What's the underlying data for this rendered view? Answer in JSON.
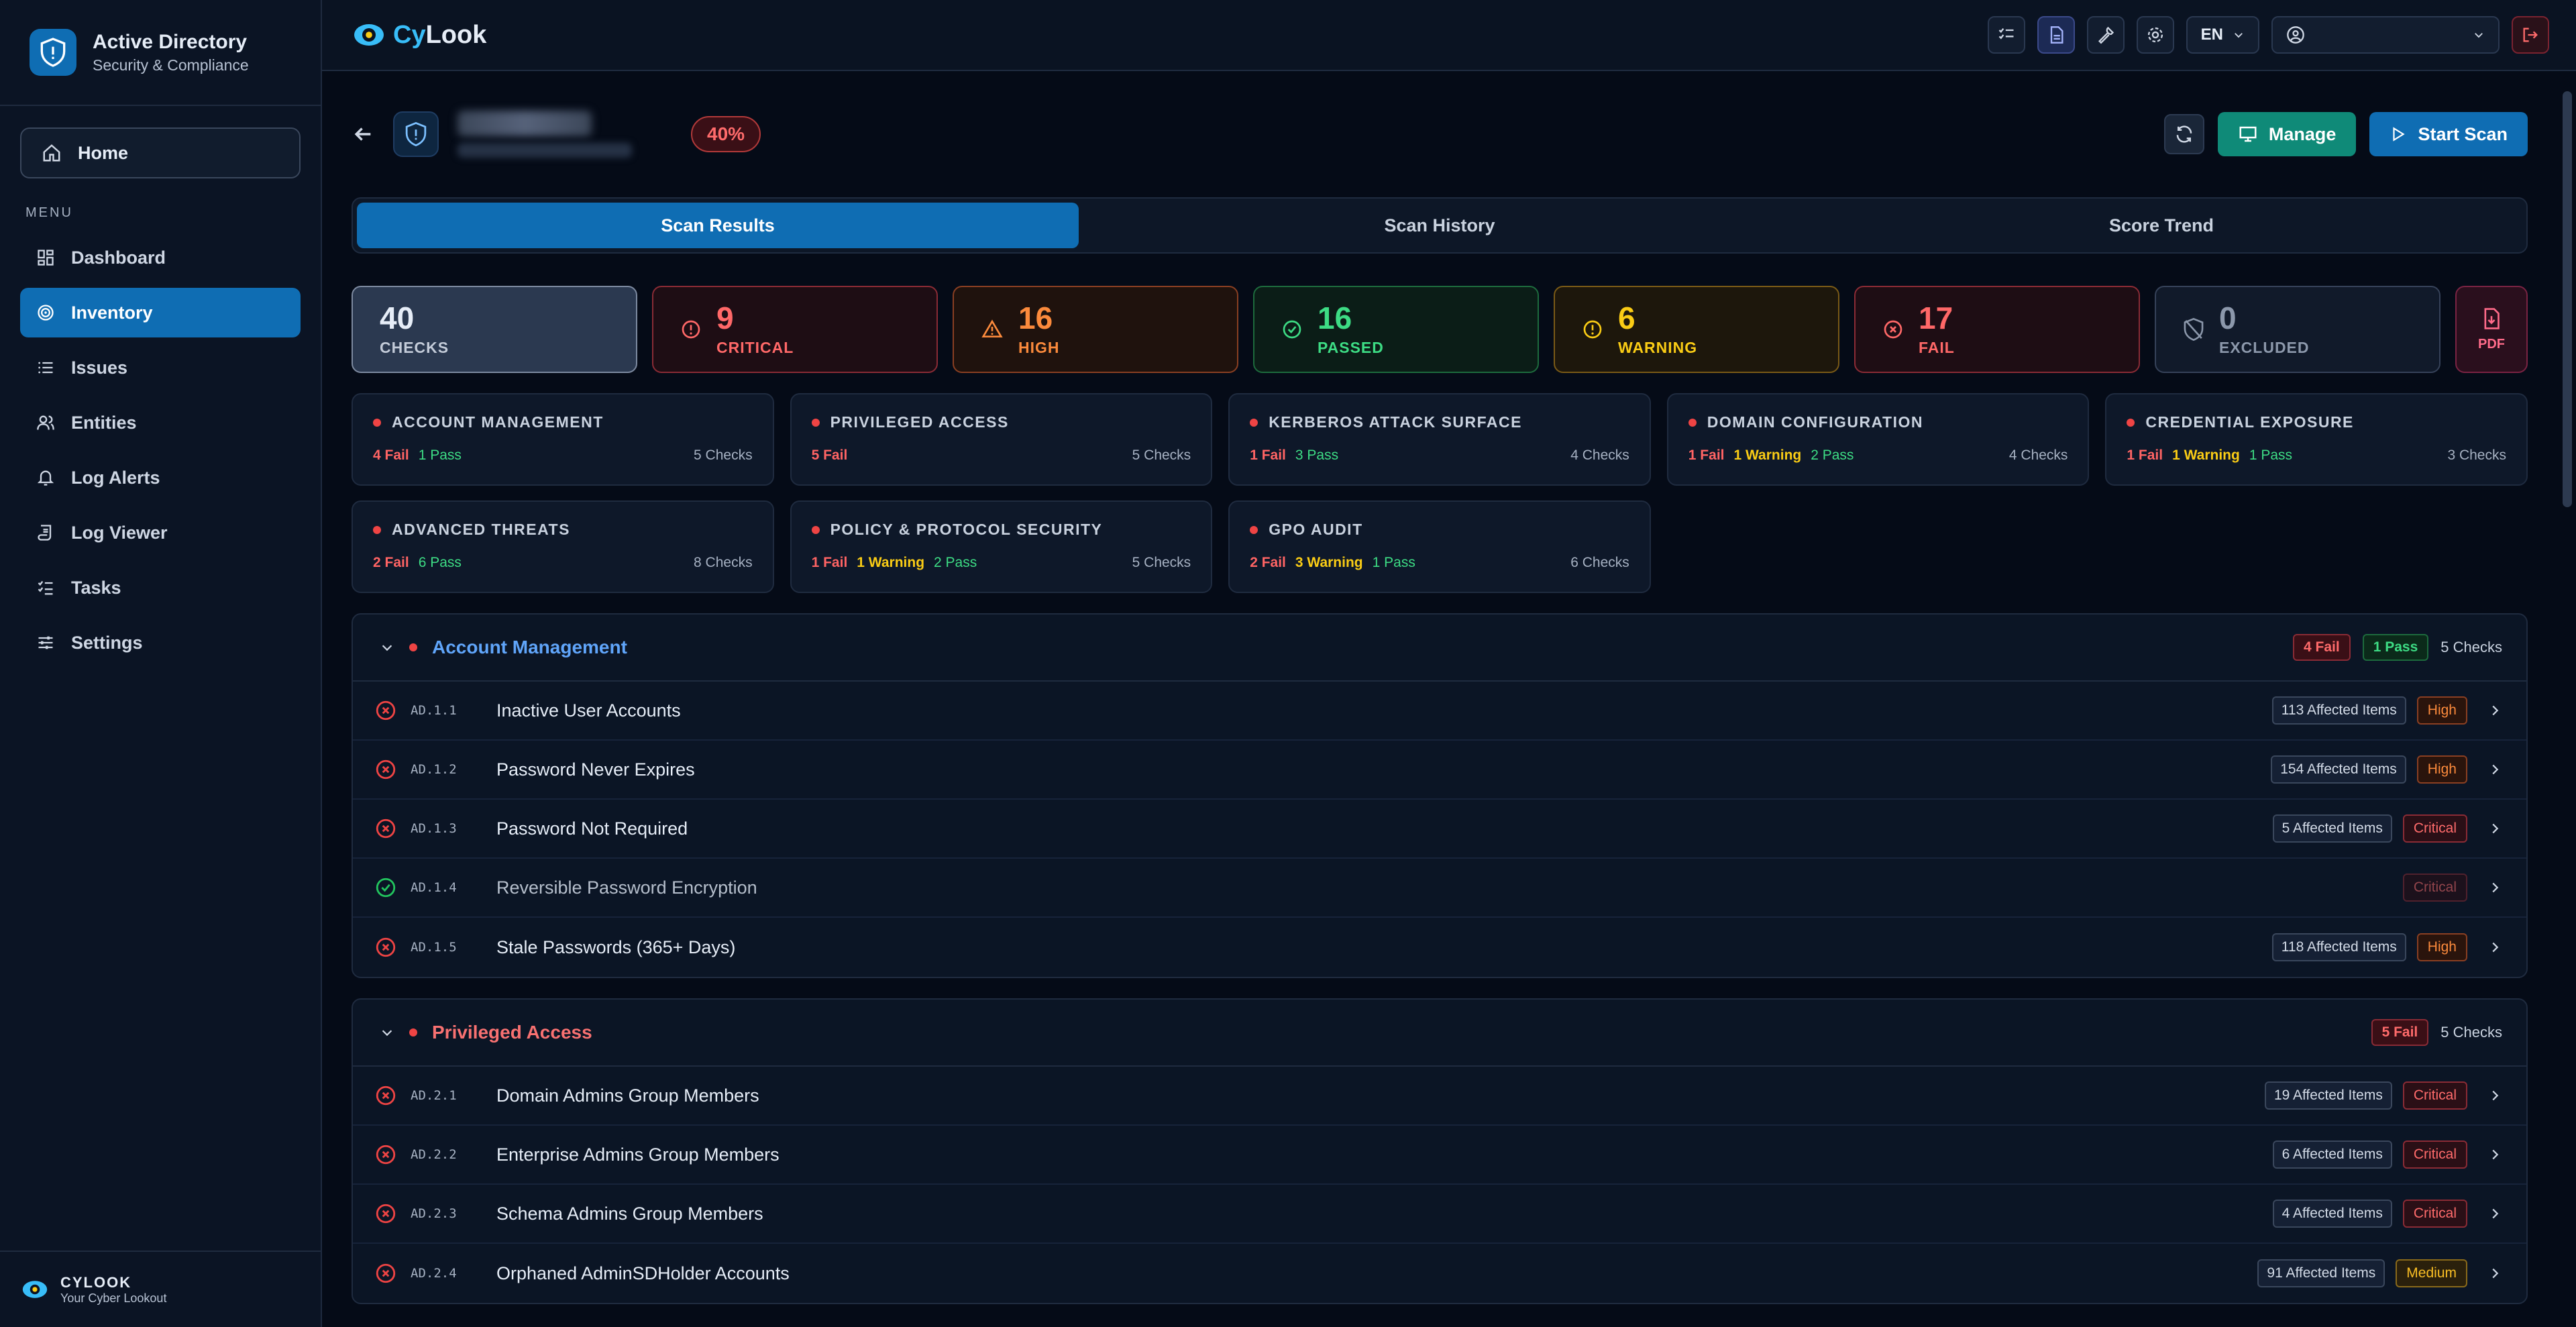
{
  "sidebar": {
    "title": "Active Directory",
    "subtitle": "Security & Compliance",
    "home": "Home",
    "menu_label": "MENU",
    "items": [
      {
        "label": "Dashboard",
        "icon": "grid-icon"
      },
      {
        "label": "Inventory",
        "icon": "target-icon",
        "active": true
      },
      {
        "label": "Issues",
        "icon": "list-icon"
      },
      {
        "label": "Entities",
        "icon": "users-icon"
      },
      {
        "label": "Log Alerts",
        "icon": "bell-icon"
      },
      {
        "label": "Log Viewer",
        "icon": "scroll-icon"
      },
      {
        "label": "Tasks",
        "icon": "checklist-icon"
      },
      {
        "label": "Settings",
        "icon": "sliders-icon"
      }
    ],
    "footer_title": "CYLOOK",
    "footer_sub": "Your Cyber Lookout"
  },
  "topbar": {
    "logo_cy": "Cy",
    "logo_rest": "Look",
    "lang": "EN"
  },
  "header": {
    "score": "40%",
    "refresh_icon": "refresh-icon",
    "manage": "Manage",
    "start_scan": "Start Scan"
  },
  "tabs": [
    "Scan Results",
    "Scan History",
    "Score Trend"
  ],
  "stats": {
    "checks": {
      "value": "40",
      "label": "CHECKS"
    },
    "critical": {
      "value": "9",
      "label": "CRITICAL"
    },
    "high": {
      "value": "16",
      "label": "HIGH"
    },
    "passed": {
      "value": "16",
      "label": "PASSED"
    },
    "warning": {
      "value": "6",
      "label": "WARNING"
    },
    "fail": {
      "value": "17",
      "label": "FAIL"
    },
    "excluded": {
      "value": "0",
      "label": "EXCLUDED"
    },
    "pdf": "PDF"
  },
  "categories": [
    {
      "title": "ACCOUNT MANAGEMENT",
      "fail": "4 Fail",
      "warning": "",
      "pass": "1 Pass",
      "checks": "5 Checks"
    },
    {
      "title": "PRIVILEGED ACCESS",
      "fail": "5 Fail",
      "warning": "",
      "pass": "",
      "checks": "5 Checks"
    },
    {
      "title": "KERBEROS ATTACK SURFACE",
      "fail": "1 Fail",
      "warning": "",
      "pass": "3 Pass",
      "checks": "4 Checks"
    },
    {
      "title": "DOMAIN CONFIGURATION",
      "fail": "1 Fail",
      "warning": "1 Warning",
      "pass": "2 Pass",
      "checks": "4 Checks"
    },
    {
      "title": "CREDENTIAL EXPOSURE",
      "fail": "1 Fail",
      "warning": "1 Warning",
      "pass": "1 Pass",
      "checks": "3 Checks"
    },
    {
      "title": "ADVANCED THREATS",
      "fail": "2 Fail",
      "warning": "",
      "pass": "6 Pass",
      "checks": "8 Checks"
    },
    {
      "title": "POLICY & PROTOCOL SECURITY",
      "fail": "1 Fail",
      "warning": "1 Warning",
      "pass": "2 Pass",
      "checks": "5 Checks"
    },
    {
      "title": "GPO AUDIT",
      "fail": "2 Fail",
      "warning": "3 Warning",
      "pass": "1 Pass",
      "checks": "6 Checks"
    }
  ],
  "sections": [
    {
      "title": "Account Management",
      "title_color": "#60a5fa",
      "fail": "4 Fail",
      "pass": "1 Pass",
      "checks": "5 Checks",
      "rows": [
        {
          "status": "fail",
          "code": "AD.1.1",
          "name": "Inactive User Accounts",
          "affected": "113 Affected Items",
          "severity": "High"
        },
        {
          "status": "fail",
          "code": "AD.1.2",
          "name": "Password Never Expires",
          "affected": "154 Affected Items",
          "severity": "High"
        },
        {
          "status": "fail",
          "code": "AD.1.3",
          "name": "Password Not Required",
          "affected": "5 Affected Items",
          "severity": "Critical"
        },
        {
          "status": "pass",
          "code": "AD.1.4",
          "name": "Reversible Password Encryption",
          "affected": "",
          "severity": "Critical"
        },
        {
          "status": "fail",
          "code": "AD.1.5",
          "name": "Stale Passwords (365+ Days)",
          "affected": "118 Affected Items",
          "severity": "High"
        }
      ]
    },
    {
      "title": "Privileged Access",
      "title_color": "#f87171",
      "fail": "5 Fail",
      "pass": "",
      "checks": "5 Checks",
      "rows": [
        {
          "status": "fail",
          "code": "AD.2.1",
          "name": "Domain Admins Group Members",
          "affected": "19 Affected Items",
          "severity": "Critical"
        },
        {
          "status": "fail",
          "code": "AD.2.2",
          "name": "Enterprise Admins Group Members",
          "affected": "6 Affected Items",
          "severity": "Critical"
        },
        {
          "status": "fail",
          "code": "AD.2.3",
          "name": "Schema Admins Group Members",
          "affected": "4 Affected Items",
          "severity": "Critical"
        },
        {
          "status": "fail",
          "code": "AD.2.4",
          "name": "Orphaned AdminSDHolder Accounts",
          "affected": "91 Affected Items",
          "severity": "Medium"
        }
      ]
    }
  ]
}
